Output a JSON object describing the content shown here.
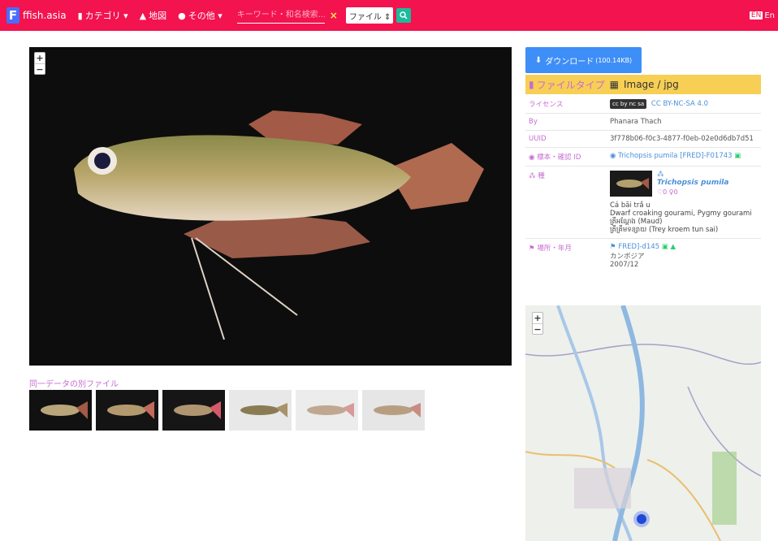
{
  "topbar": {
    "logo_mark": "F",
    "logo_text": "ffish.asia",
    "category": "カテゴリ",
    "map": "地図",
    "other": "その他",
    "search_placeholder": "キーワード・和名検索...",
    "clear": "×",
    "file_select": "ファイル ⇕",
    "lang_flag": "EN",
    "lang": "En"
  },
  "viewer": {
    "zoom_in": "+",
    "zoom_out": "−"
  },
  "related": {
    "title": "同一データの別ファイル"
  },
  "download": {
    "label": "ダウンロード",
    "size": "(100.14KB)"
  },
  "filetype": {
    "label": "ファイルタイプ",
    "value": "Image / jpg"
  },
  "info": {
    "license_key": "ライセンス",
    "license_badge": "cc by nc sa",
    "license_val": "CC BY-NC-SA 4.0",
    "by_key": "By",
    "by_val": "Phanara Thach",
    "uuid_key": "UUID",
    "uuid_val": "3f778b06-f0c3-4877-f0eb-02e0d6db7d51",
    "specimen_key": "標本・確認 ID",
    "specimen_val": "Trichopsis pumila [FRED]-F01743",
    "species_key": "種",
    "species_name": "Trichopsis pumila",
    "counts": "♡0 ♀0",
    "names": [
      "Cá bãi trầ u",
      "Dwarf croaking gourami, Pygmy gourami",
      "ត្រីអណ្ដែង (Maud)",
      "ត្រីគ្រឹមទន្សាយ (Trey kroem tun sai)"
    ],
    "place_key": "場所・年月",
    "place_id": "FRED]-d145",
    "country": "カンボジア",
    "date": "2007/12"
  },
  "map": {
    "zoom_in": "+",
    "zoom_out": "−"
  }
}
